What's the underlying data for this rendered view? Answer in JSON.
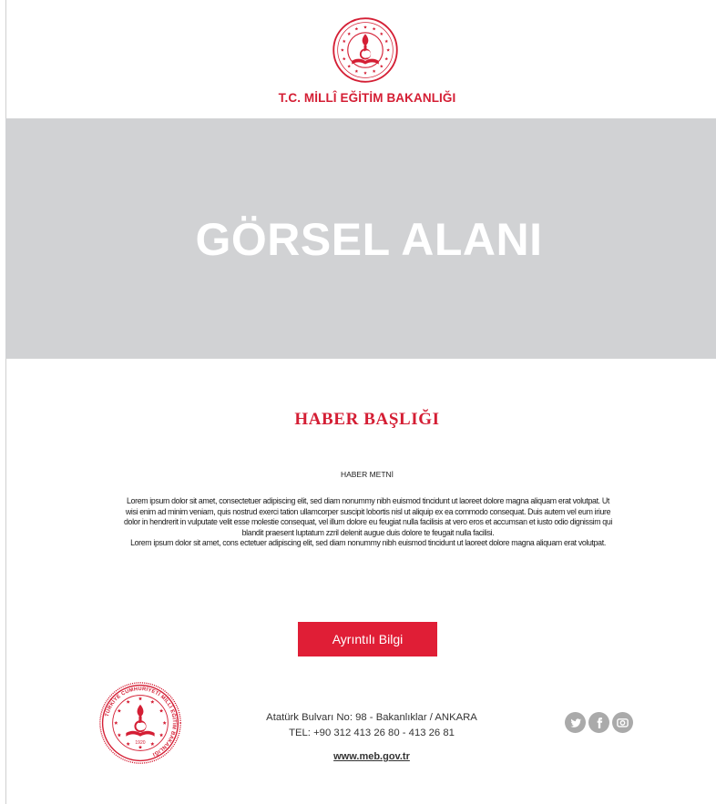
{
  "header": {
    "ministry_name": "T.C. MİLLÎ EĞİTİM BAKANLIĞI",
    "logo_icon": "meb-emblem-icon"
  },
  "hero": {
    "placeholder_text": "GÖRSEL ALANI"
  },
  "news": {
    "title": "HABER BAŞLIĞI",
    "label": "HABER METNİ",
    "paragraph_1": "Lorem ipsum dolor sit amet, consectetuer adipiscing elit, sed diam nonummy nibh euismod tincidunt ut laoreet dolore magna aliquam erat volutpat. Ut wisi enim ad minim veniam, quis nostrud exerci tation ullamcorper suscipit lobortis nisl ut aliquip ex ea commodo consequat. Duis autem vel eum iriure dolor in hendrerit in vulputate velit esse molestie consequat, vel illum dolore eu feugiat nulla facilisis at vero eros et accumsan et iusto odio dignissim qui blandit praesent luptatum zzril delenit augue duis dolore te feugait nulla facilisi.",
    "paragraph_2": "Lorem ipsum dolor sit amet, cons ectetuer adipiscing elit, sed diam nonummy nibh euismod tincidunt ut laoreet dolore magna aliquam erat volutpat.",
    "button_label": "Ayrıntılı Bilgi"
  },
  "footer": {
    "address_line": "Atatürk Bulvarı No: 98 - Bakanlıklar / ANKARA",
    "phone_line": "TEL: +90 312 413 26 80 - 413 26 81",
    "website": "www.meb.gov.tr",
    "seal_text": "TÜRKİYE CUMHURİYETİ MİLLÎ EĞİTİM BAKANLIĞI",
    "seal_year": "1920",
    "social_icons": [
      "twitter-icon",
      "facebook-icon",
      "instagram-icon"
    ]
  },
  "colors": {
    "brand_red": "#d41e34",
    "button_red": "#e01e36",
    "hero_gray": "#d1d2d4",
    "social_gray": "#aaaaaa"
  }
}
